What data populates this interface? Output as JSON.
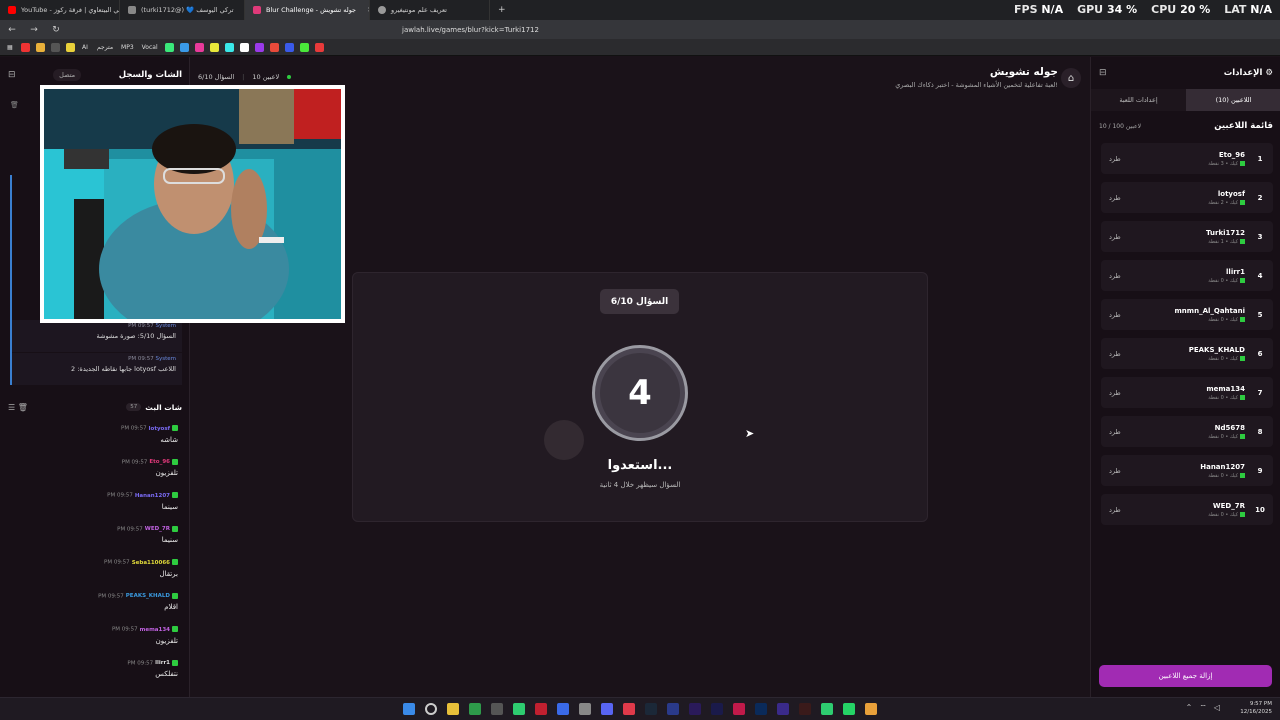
{
  "browser": {
    "tabs": [
      {
        "label": "YouTube - ميداني البيتعاوي | فرقة ركوز",
        "color": "#ff0000"
      },
      {
        "label": "(turki1712@) 💙 تركي اليوسف",
        "color": "#888888"
      },
      {
        "label": "Blur Challenge - جوله تشويش",
        "color": "#e03a7a",
        "active": true
      },
      {
        "label": "تعريف علم مونتيغيرو",
        "color": "#999999"
      }
    ],
    "new_tab": "+",
    "url": "jawlah.live/games/blur?kick=Turki1712",
    "stats": [
      {
        "label": "FPS",
        "value": "N/A"
      },
      {
        "label": "GPU",
        "value": "34 %"
      },
      {
        "label": "CPU",
        "value": "20 %"
      },
      {
        "label": "LAT",
        "value": "N/A"
      }
    ],
    "bookmarks": [
      "AI",
      "مترجم",
      "MP3",
      "Vocal"
    ]
  },
  "chat_panel": {
    "title": "الشات والسجل",
    "status": "متصل",
    "system_messages": [
      {
        "time": "PM 09:57",
        "sender": "System",
        "text": "السؤال 5/10: صورة مشوشة"
      },
      {
        "time": "PM 09:57",
        "sender": "System",
        "text": "اللاعب lotyosf جابها نقاطه الجديدة: 2"
      }
    ],
    "broadcast": {
      "title": "شات البث",
      "count": "57",
      "messages": [
        {
          "time": "PM 09:57",
          "user": "lotyosf",
          "color": "#7b6cf6",
          "text": "شاشه"
        },
        {
          "time": "PM 09:57",
          "user": "Eto_96",
          "color": "#e0397a",
          "text": "تلفزيون"
        },
        {
          "time": "PM 09:57",
          "user": "Hanan1207",
          "color": "#7b6cf6",
          "text": "سينما"
        },
        {
          "time": "PM 09:57",
          "user": "WED_7R",
          "color": "#c062e0",
          "text": "سنيما"
        },
        {
          "time": "PM 09:57",
          "user": "Seba110066",
          "color": "#e0d93a",
          "text": "برتقال"
        },
        {
          "time": "PM 09:57",
          "user": "PEAKS_KHALD",
          "color": "#3a9ae0",
          "text": "اقلام"
        },
        {
          "time": "PM 09:57",
          "user": "mema134",
          "color": "#c062e0",
          "text": "تلفزيون"
        },
        {
          "time": "PM 09:57",
          "user": "llirr1",
          "color": "#dddddd",
          "text": "نتفلكس"
        }
      ]
    }
  },
  "game": {
    "title": "جوله تشويش",
    "subtitle": "لعبة تفاعلية لتخمين الأشياء المشوشة - اختبر ذكاءك البصري!",
    "players_info": "10 لاعبين",
    "question_info": "السؤال 6/10",
    "question_badge": "السؤال 6/10",
    "countdown": "4",
    "ready": "استعدوا...",
    "ready_sub": "السؤال سيظهر خلال 4 ثانية"
  },
  "settings_panel": {
    "title": "الإعدادات",
    "tabs": [
      {
        "label": "اللاعبين (10)",
        "active": true
      },
      {
        "label": "إعدادات اللعبة",
        "active": false
      }
    ],
    "list_title": "قائمة اللاعبين",
    "list_count": "10 / 100 لاعبين",
    "kick_label": "طرد",
    "players": [
      {
        "rank": "1",
        "name": "Eto_96",
        "points": "كيك • 3 نقطة"
      },
      {
        "rank": "2",
        "name": "lotyosf",
        "points": "كيك • 2 نقطة"
      },
      {
        "rank": "3",
        "name": "Turki1712",
        "points": "كيك • 1 نقطة"
      },
      {
        "rank": "4",
        "name": "llirr1",
        "points": "كيك • 0 نقطة"
      },
      {
        "rank": "5",
        "name": "mnmn_Al_Qahtani",
        "points": "كيك • 0 نقطة"
      },
      {
        "rank": "6",
        "name": "PEAKS_KHALD",
        "points": "كيك • 0 نقطة"
      },
      {
        "rank": "7",
        "name": "mema134",
        "points": "كيك • 0 نقطة"
      },
      {
        "rank": "8",
        "name": "Nd5678",
        "points": "كيك • 0 نقطة"
      },
      {
        "rank": "9",
        "name": "Hanan1207",
        "points": "كيك • 0 نقطة"
      },
      {
        "rank": "10",
        "name": "WED_7R",
        "points": "كيك • 0 نقطة"
      }
    ],
    "remove_all": "إزالة جميع اللاعبين"
  },
  "taskbar": {
    "time": "9:57 PM",
    "date": "12/16/2025"
  }
}
